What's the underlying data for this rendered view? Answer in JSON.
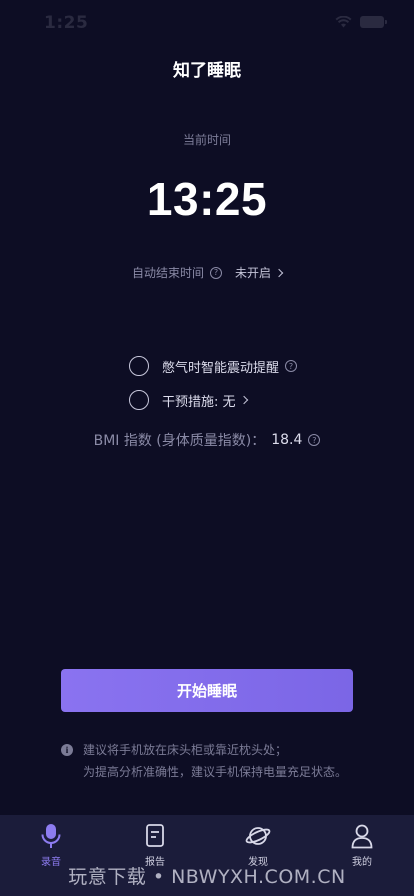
{
  "status_bar": {
    "time": "1:25"
  },
  "header": {
    "title": "知了睡眠"
  },
  "clock": {
    "label": "当前时间",
    "time": "13:25"
  },
  "auto_end": {
    "label": "自动结束时间",
    "value": "未开启"
  },
  "options": [
    {
      "label": "憋气时智能震动提醒",
      "checked": false
    },
    {
      "label": "干预措施: 无",
      "checked": false
    }
  ],
  "bmi": {
    "label": "BMI 指数 (身体质量指数)：",
    "value": "18.4"
  },
  "start_button": {
    "label": "开始睡眠"
  },
  "tips": {
    "line1": "建议将手机放在床头柜或靠近枕头处；",
    "line2": "为提高分析准确性，建议手机保持电量充足状态。"
  },
  "tabbar": {
    "items": [
      {
        "label": "录音",
        "icon": "microphone-icon",
        "active": true
      },
      {
        "label": "报告",
        "icon": "report-icon",
        "active": false
      },
      {
        "label": "发现",
        "icon": "planet-icon",
        "active": false
      },
      {
        "label": "我的",
        "icon": "person-icon",
        "active": false
      }
    ]
  },
  "watermark": "玩意下载 • NBWYXH.COM.CN",
  "colors": {
    "background": "#0d0d24",
    "accent": "#8a73f0",
    "tabbar": "#1b1c3a"
  }
}
